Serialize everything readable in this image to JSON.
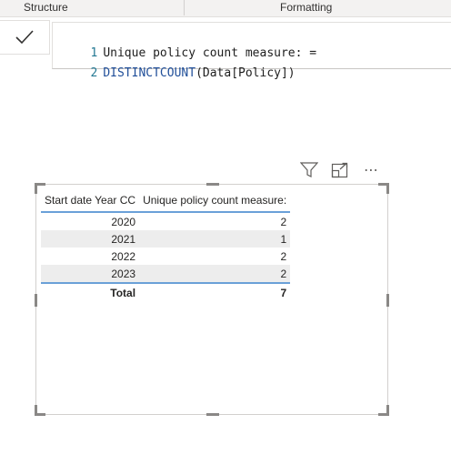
{
  "ribbon": {
    "structure_label": "Structure",
    "formatting_label": "Formatting"
  },
  "editor": {
    "lines": [
      {
        "number": "1",
        "text": "Unique policy count measure: ="
      },
      {
        "number": "2",
        "func": "DISTINCTCOUNT",
        "args": "(Data[Policy])"
      }
    ]
  },
  "visual_header": {
    "icons": [
      "filter-icon",
      "focus-mode-icon",
      "more-options-icon"
    ],
    "more_glyph": "⋯"
  },
  "table": {
    "columns": [
      "Start date Year CC",
      "Unique policy count measure:"
    ],
    "rows": [
      {
        "year": "2020",
        "count": "2"
      },
      {
        "year": "2021",
        "count": "1"
      },
      {
        "year": "2022",
        "count": "2"
      },
      {
        "year": "2023",
        "count": "2"
      }
    ],
    "total": {
      "label": "Total",
      "value": "7"
    }
  },
  "colors": {
    "header_underline": "#6aa0d8",
    "band_row": "#ededed",
    "line_numbers": "#237893",
    "function_keyword": "#1f4e99"
  }
}
